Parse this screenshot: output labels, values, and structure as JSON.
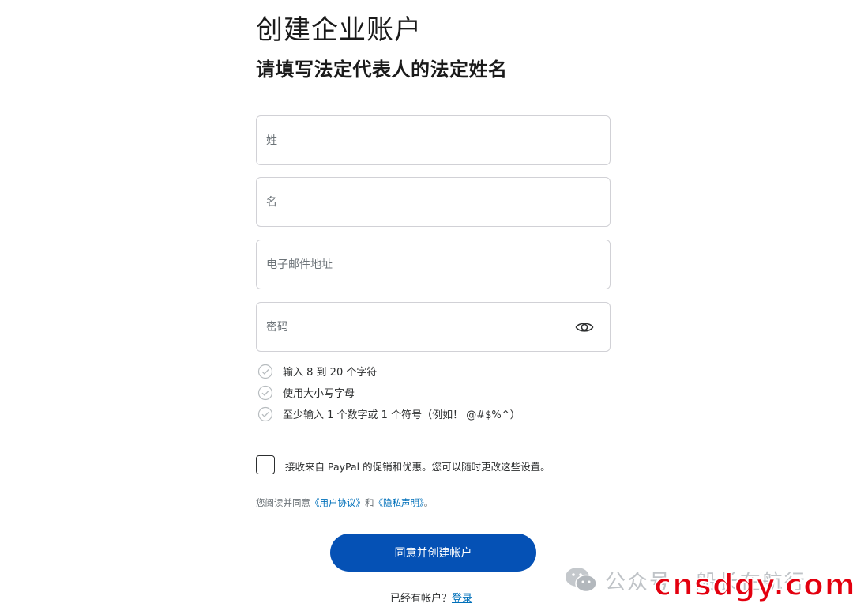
{
  "header": {
    "title": "创建企业账户",
    "subtitle": "请填写法定代表人的法定姓名"
  },
  "form": {
    "last_name": {
      "placeholder": "姓",
      "value": ""
    },
    "first_name": {
      "placeholder": "名",
      "value": ""
    },
    "email": {
      "placeholder": "电子邮件地址",
      "value": ""
    },
    "password": {
      "placeholder": "密码",
      "value": "",
      "toggle_icon": "eye-icon"
    }
  },
  "password_rules": [
    {
      "text": "输入 8 到 20 个字符",
      "icon": "check-circle-icon"
    },
    {
      "text": "使用大小写字母",
      "icon": "check-circle-icon"
    },
    {
      "text": "至少输入 1 个数字或 1 个符号（例如！ @#$%^）",
      "icon": "check-circle-icon"
    }
  ],
  "promo": {
    "checked": false,
    "label": "接收来自 PayPal 的促销和优惠。您可以随时更改这些设置。"
  },
  "agreement": {
    "prefix": "您阅读并同意",
    "user_agreement": "《用户协议》",
    "and": "和",
    "privacy": "《隐私声明》",
    "suffix": "。"
  },
  "submit": {
    "label": "同意并创建帐户"
  },
  "login": {
    "prompt": "已经有帐户？",
    "link": "登录"
  },
  "watermark": {
    "channel": "公众号 · 船长在航行",
    "domain": "cnsdgy.com"
  },
  "colors": {
    "primary_button": "#0551b5",
    "link": "#0070ba",
    "border": "#d1d1d6",
    "watermark_red": "#e3000f"
  }
}
